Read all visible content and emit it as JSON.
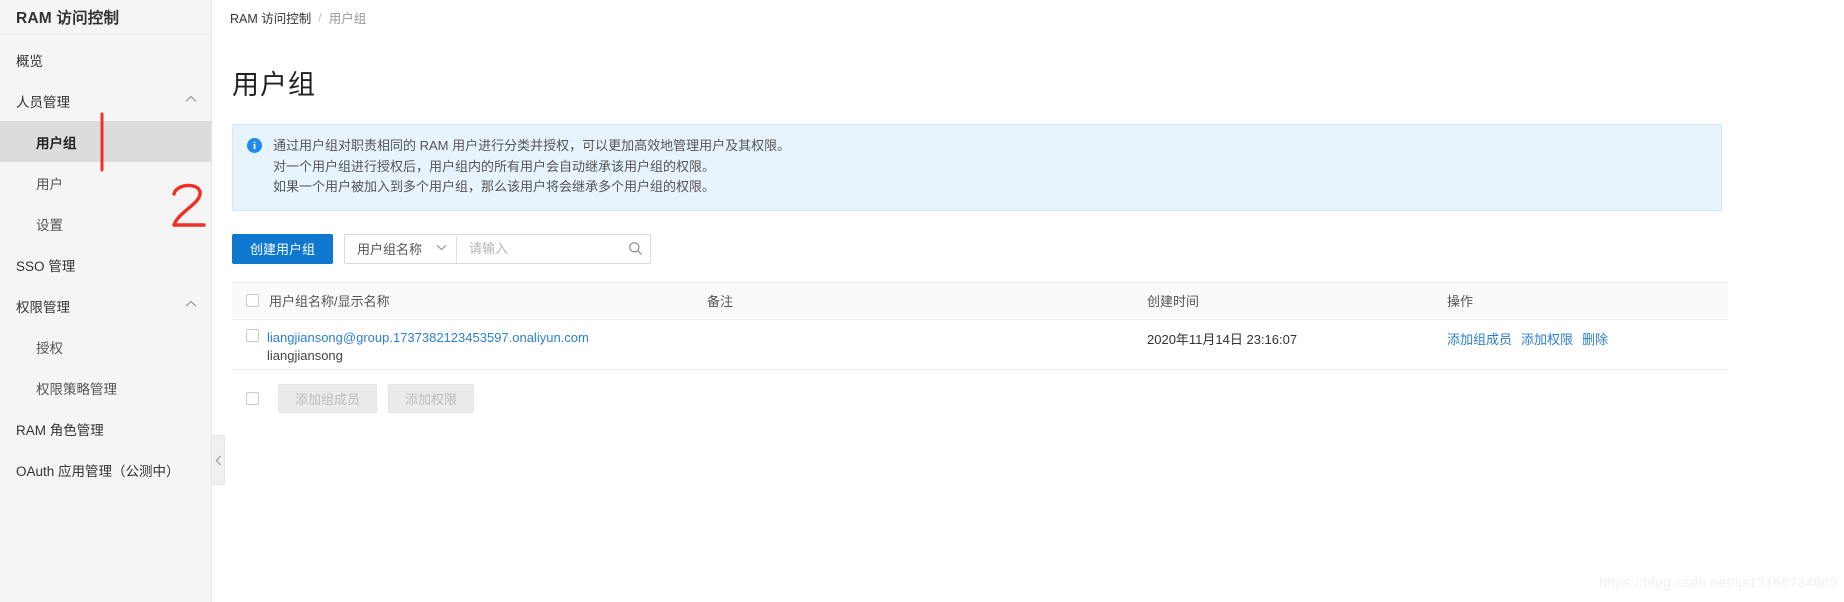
{
  "sidebar": {
    "title": "RAM 访问控制",
    "items": [
      {
        "label": "概览",
        "level": "top",
        "active": false,
        "expandable": false
      },
      {
        "label": "人员管理",
        "level": "top",
        "active": false,
        "expandable": true
      },
      {
        "label": "用户组",
        "level": "sub",
        "active": true,
        "expandable": false
      },
      {
        "label": "用户",
        "level": "sub",
        "active": false,
        "expandable": false
      },
      {
        "label": "设置",
        "level": "sub",
        "active": false,
        "expandable": false
      },
      {
        "label": "SSO 管理",
        "level": "top",
        "active": false,
        "expandable": false
      },
      {
        "label": "权限管理",
        "level": "top",
        "active": false,
        "expandable": true
      },
      {
        "label": "授权",
        "level": "sub",
        "active": false,
        "expandable": false
      },
      {
        "label": "权限策略管理",
        "level": "sub",
        "active": false,
        "expandable": false
      },
      {
        "label": "RAM 角色管理",
        "level": "top",
        "active": false,
        "expandable": false
      },
      {
        "label": "OAuth 应用管理（公测中）",
        "level": "top",
        "active": false,
        "expandable": false
      }
    ],
    "collapse_handle": "‹"
  },
  "breadcrumb": {
    "root": "RAM 访问控制",
    "separator": "/",
    "current": "用户组"
  },
  "page": {
    "title": "用户组"
  },
  "banner": {
    "icon": "i",
    "line1": "通过用户组对职责相同的 RAM 用户进行分类并授权，可以更加高效地管理用户及其权限。",
    "line2": "对一个用户组进行授权后，用户组内的所有用户会自动继承该用户组的权限。",
    "line3": "如果一个用户被加入到多个用户组，那么该用户将会继承多个用户组的权限。"
  },
  "toolbar": {
    "create_label": "创建用户组",
    "filter_selected": "用户组名称",
    "filter_caret": "⌄",
    "search_placeholder": "请输入",
    "search_value": "",
    "search_icon": "search-icon"
  },
  "table": {
    "headers": {
      "name": "用户组名称/显示名称",
      "note": "备注",
      "time": "创建时间",
      "ops": "操作"
    },
    "rows": [
      {
        "group_name": "liangjiansong@group.1737382123453597.onaliyun.com",
        "display_name": "liangjiansong",
        "note": "",
        "created_at": "2020年11月14日 23:16:07",
        "operations": [
          "添加组成员",
          "添加权限",
          "删除"
        ]
      }
    ]
  },
  "bulk_actions": {
    "add_members_label": "添加组成员",
    "add_permission_label": "添加权限"
  },
  "annotations": {
    "mark_sidebar": "1-stroke",
    "mark_toolbar": "2"
  },
  "watermark": {
    "text": "https://blog.csdn.net/ljs13168734665"
  },
  "colors": {
    "primary": "#0e77d0",
    "link": "#2b7fd1",
    "banner_bg": "#e7f4fd",
    "annotation_red": "#ee3124",
    "sidebar_bg": "#f5f5f5",
    "active_bg": "#dcdcdc"
  }
}
